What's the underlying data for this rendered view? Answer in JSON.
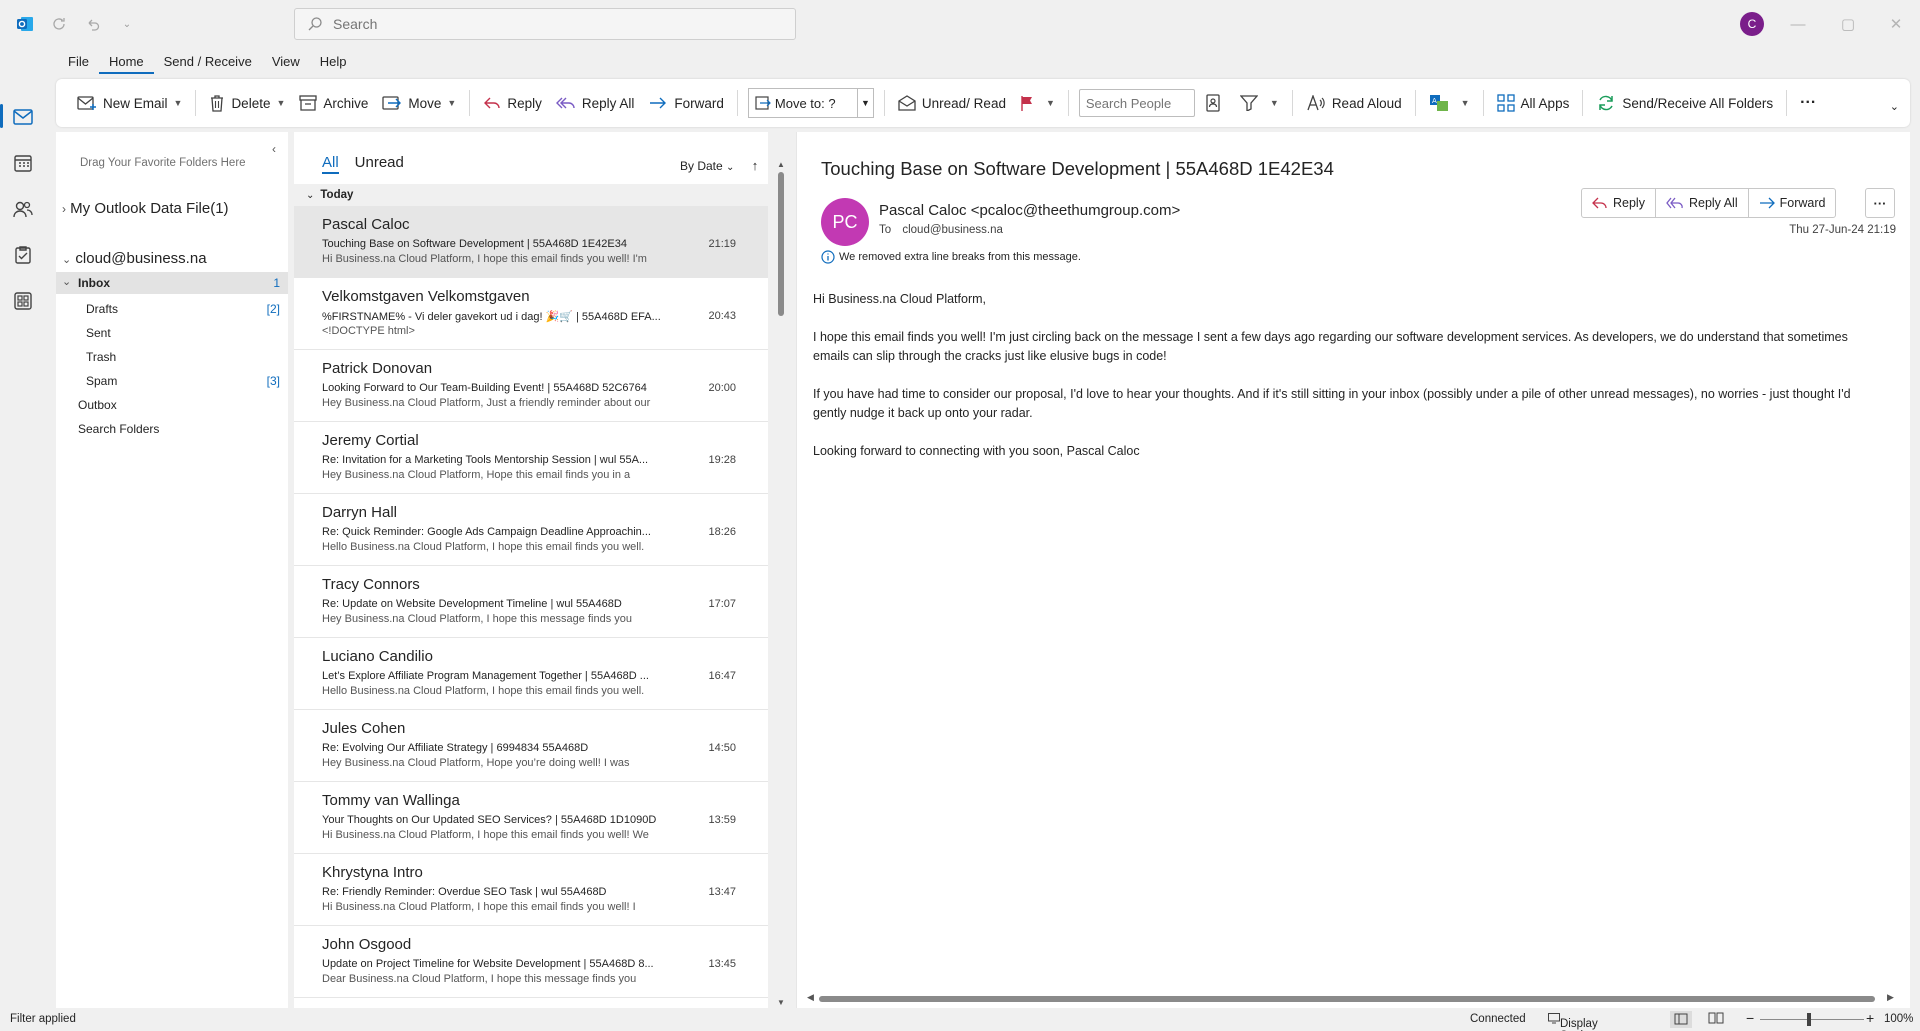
{
  "titlebar": {
    "search_placeholder": "Search",
    "user_initial": "C"
  },
  "menu_tabs": [
    "File",
    "Home",
    "Send / Receive",
    "View",
    "Help"
  ],
  "ribbon": {
    "new_email": "New Email",
    "delete": "Delete",
    "archive": "Archive",
    "move": "Move",
    "reply": "Reply",
    "reply_all": "Reply All",
    "forward": "Forward",
    "move_to": "Move to: ?",
    "unread_read": "Unread/ Read",
    "search_people_placeholder": "Search People",
    "read_aloud": "Read Aloud",
    "all_apps": "All Apps",
    "send_receive_all": "Send/Receive All Folders"
  },
  "folder_pane": {
    "drag_hint": "Drag Your Favorite Folders Here",
    "data_file": "My Outlook Data File(1)",
    "account": "cloud@business.na",
    "folders": [
      {
        "name": "Inbox",
        "count": "1"
      },
      {
        "name": "Drafts",
        "count": "[2]"
      },
      {
        "name": "Sent",
        "count": ""
      },
      {
        "name": "Trash",
        "count": ""
      },
      {
        "name": "Spam",
        "count": "[3]"
      },
      {
        "name": "Outbox",
        "count": ""
      },
      {
        "name": "Search Folders",
        "count": ""
      }
    ]
  },
  "message_list": {
    "filter_all": "All",
    "filter_unread": "Unread",
    "sort": "By Date",
    "group": "Today",
    "messages": [
      {
        "sender": "Pascal Caloc",
        "subject": "Touching Base on Software Development | 55A468D 1E42E34",
        "preview": "Hi Business.na Cloud Platform,  I hope this email finds you well! I'm",
        "time": "21:19"
      },
      {
        "sender": "Velkomstgaven Velkomstgaven",
        "subject": "%FIRSTNAME% - Vi deler gavekort ud i dag! 🎉🛒 | 55A468D EFA...",
        "preview": "<!DOCTYPE html>",
        "time": "20:43"
      },
      {
        "sender": "Patrick Donovan",
        "subject": "Looking Forward to Our Team-Building Event! | 55A468D 52C6764",
        "preview": "Hey Business.na Cloud Platform,  Just a friendly reminder about our",
        "time": "20:00"
      },
      {
        "sender": "Jeremy Cortial",
        "subject": "Re: Invitation for a Marketing Tools Mentorship Session | wul 55A...",
        "preview": "Hey Business.na Cloud Platform,  Hope this email finds you in a",
        "time": "19:28"
      },
      {
        "sender": "Darryn Hall",
        "subject": "Re: Quick Reminder: Google Ads Campaign Deadline Approachin...",
        "preview": "Hello Business.na Cloud Platform,  I hope this email finds you well.",
        "time": "18:26"
      },
      {
        "sender": "Tracy Connors",
        "subject": "Re: Update on Website Development Timeline | wul 55A468D",
        "preview": "Hey Business.na Cloud Platform,  I hope this message finds you",
        "time": "17:07"
      },
      {
        "sender": "Luciano Candilio",
        "subject": "Let’s Explore Affiliate Program Management Together | 55A468D ...",
        "preview": "Hello Business.na Cloud Platform,  I hope this email finds you well.",
        "time": "16:47"
      },
      {
        "sender": "Jules Cohen",
        "subject": "Re: Evolving Our Affiliate Strategy | 6994834 55A468D",
        "preview": "Hey Business.na Cloud Platform,  Hope you’re doing well! I was",
        "time": "14:50"
      },
      {
        "sender": "Tommy van Wallinga",
        "subject": "Your Thoughts on Our Updated SEO Services? | 55A468D 1D1090D",
        "preview": "Hi Business.na Cloud Platform,  I hope this email finds you well! We",
        "time": "13:59"
      },
      {
        "sender": "Khrystyna Intro",
        "subject": "Re: Friendly Reminder: Overdue SEO Task | wul 55A468D",
        "preview": "Hi Business.na Cloud Platform,  I hope this email finds you well! I",
        "time": "13:47"
      },
      {
        "sender": "John Osgood",
        "subject": "Update on Project Timeline for Website Development | 55A468D 8...",
        "preview": "Dear Business.na Cloud Platform,  I hope this message finds you",
        "time": "13:45"
      }
    ]
  },
  "reading_pane": {
    "subject": "Touching Base on Software Development | 55A468D 1E42E34",
    "avatar_initials": "PC",
    "from": "Pascal Caloc <pcaloc@theethumgroup.com>",
    "to_label": "To",
    "to": "cloud@business.na",
    "info": "We removed extra line breaks from this message.",
    "reply": "Reply",
    "reply_all": "Reply All",
    "forward": "Forward",
    "date": "Thu 27-Jun-24 21:19",
    "body": [
      "Hi Business.na Cloud Platform,",
      "I hope this email finds you well! I'm just circling back on the message I sent a few days ago regarding our software development services. As developers, we do understand that sometimes emails can slip through the cracks just like elusive bugs in code!",
      "If you have had time to consider our proposal, I'd love to hear your thoughts. And if it's still sitting in your inbox (possibly under a pile of other unread messages), no worries - just thought I'd gently nudge it back up onto your radar.",
      "Looking forward to connecting with you soon, Pascal Caloc"
    ]
  },
  "statusbar": {
    "filter": "Filter applied",
    "connected": "Connected",
    "display_settings": "Display Settings",
    "zoom": "100%"
  },
  "colors": {
    "accent": "#0f6cbd",
    "avatar_pc": "#c239b3",
    "avatar_c": "#7a1e8a"
  }
}
